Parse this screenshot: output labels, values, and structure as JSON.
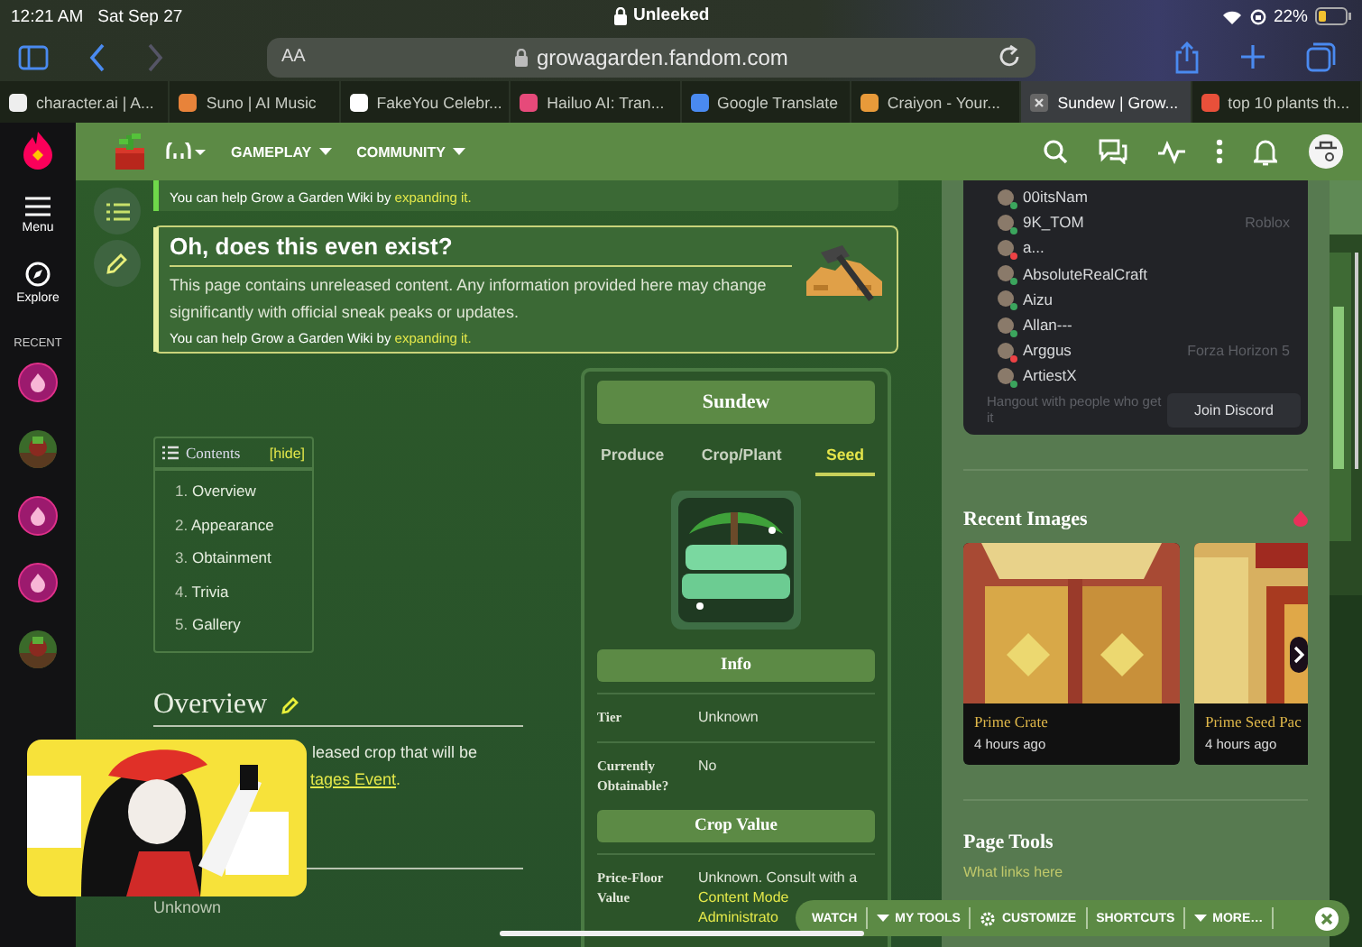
{
  "status_bar": {
    "time": "12:21 AM",
    "date": "Sat Sep 27",
    "title": "Unleeked",
    "battery": "22%"
  },
  "browser": {
    "text_size": "AA",
    "url": "growagarden.fandom.com"
  },
  "tabs": [
    {
      "label": "character.ai | A...",
      "selected": false
    },
    {
      "label": "Suno | AI Music",
      "selected": false
    },
    {
      "label": "FakeYou Celebr...",
      "selected": false
    },
    {
      "label": "Hailuo AI: Tran...",
      "selected": false
    },
    {
      "label": "Google Translate",
      "selected": false
    },
    {
      "label": "Craiyon - Your...",
      "selected": false
    },
    {
      "label": "Sundew | Grow...",
      "selected": true
    },
    {
      "label": "top 10 plants th...",
      "selected": false
    }
  ],
  "left_rail": {
    "menu": "Menu",
    "explore": "Explore",
    "recent": "RECENT",
    "recent_items": [
      {
        "kind": "flame"
      },
      {
        "kind": "picture"
      },
      {
        "kind": "flame"
      },
      {
        "kind": "flame"
      },
      {
        "kind": "picture"
      }
    ]
  },
  "nav": {
    "items": [
      {
        "label": "GAMEPLAY"
      },
      {
        "label": "COMMUNITY"
      }
    ]
  },
  "notices": [
    {
      "color": "#6fd84a",
      "help": "You can help Grow a Garden Wiki by",
      "link": "expanding it."
    },
    {
      "color": "#e6ef9c",
      "title": "Oh, does this even exist?",
      "body": "This page contains unreleased content. Any information provided here may change significantly with official sneak peaks or updates.",
      "help": "You can help Grow a Garden Wiki by",
      "link": "expanding it."
    }
  ],
  "toc": {
    "title": "Contents",
    "toggle": "[hide]",
    "items": [
      {
        "number": "1.",
        "label": "Overview"
      },
      {
        "number": "2.",
        "label": "Appearance"
      },
      {
        "number": "3.",
        "label": "Obtainment"
      },
      {
        "number": "4.",
        "label": "Trivia"
      },
      {
        "number": "5.",
        "label": "Gallery"
      }
    ]
  },
  "overview": {
    "heading": "Overview",
    "line": "leased crop that will be",
    "link": "tages Event",
    "after": ".",
    "next_value": "Unknown"
  },
  "infobox": {
    "title": "Sundew",
    "tabs": [
      {
        "label": "Produce",
        "selected": false
      },
      {
        "label": "Crop/Plant",
        "selected": false
      },
      {
        "label": "Seed",
        "selected": true
      }
    ],
    "sections": [
      {
        "title": "Info",
        "rows": [
          {
            "label": "Tier",
            "value": "Unknown"
          },
          {
            "label": "Currently Obtainable?",
            "value": "No"
          }
        ]
      },
      {
        "title": "Crop Value",
        "rows": [
          {
            "label": "Price-Floor Value",
            "value": "Unknown. Consult with a",
            "links": [
              "Content Mode",
              "Administrato"
            ]
          }
        ]
      }
    ]
  },
  "discord": {
    "members": [
      {
        "name": "00itsNam",
        "color": "#3ba55d"
      },
      {
        "name": "9K_TOM",
        "activity": "Roblox",
        "color": "#3ba55d"
      },
      {
        "name": "a...",
        "color": "#ed4245"
      },
      {
        "name": "AbsoluteRealCraft",
        "color": "#3ba55d"
      },
      {
        "name": "Aizu",
        "color": "#3ba55d"
      },
      {
        "name": "Allan---",
        "color": "#3ba55d"
      },
      {
        "name": "Arggus",
        "activity": "Forza Horizon 5",
        "color": "#ed4245"
      },
      {
        "name": "ArtiestX",
        "color": "#3ba55d"
      }
    ],
    "footer": "Hangout with people who get it",
    "button": "Join Discord"
  },
  "recent_images": {
    "title": "Recent Images",
    "cards": [
      {
        "title": "Prime Crate",
        "time": "4 hours ago"
      },
      {
        "title": "Prime Seed Pac",
        "time": "4 hours ago"
      }
    ]
  },
  "page_tools": {
    "title": "Page Tools",
    "links": [
      "What links here"
    ]
  },
  "toolbar": [
    {
      "kind": "plain",
      "label": "WATCH"
    },
    {
      "kind": "caret",
      "label": "MY TOOLS"
    },
    {
      "kind": "gear",
      "label": "CUSTOMIZE"
    },
    {
      "kind": "plain",
      "label": "SHORTCUTS"
    },
    {
      "kind": "caret",
      "label": "MORE…"
    }
  ]
}
